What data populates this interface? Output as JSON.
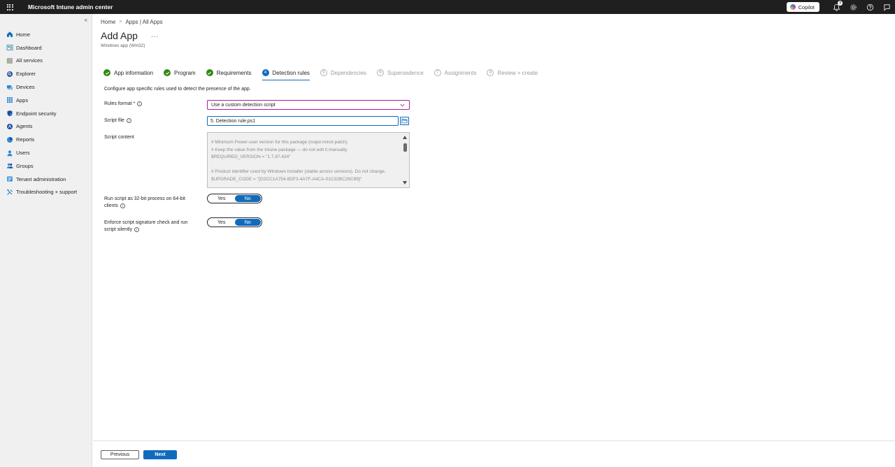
{
  "app": {
    "title": "Microsoft Intune admin center"
  },
  "topbar": {
    "copilot_label": "Copilot",
    "notification_count": "7"
  },
  "sidebar": {
    "collapse_glyph": "«",
    "items": [
      {
        "label": "Home",
        "icon": "home-icon"
      },
      {
        "label": "Dashboard",
        "icon": "dashboard-icon"
      },
      {
        "label": "All services",
        "icon": "all-services-icon"
      },
      {
        "label": "Explorer",
        "icon": "explorer-icon"
      },
      {
        "label": "Devices",
        "icon": "devices-icon"
      },
      {
        "label": "Apps",
        "icon": "apps-icon"
      },
      {
        "label": "Endpoint security",
        "icon": "endpoint-security-icon"
      },
      {
        "label": "Agents",
        "icon": "agents-icon"
      },
      {
        "label": "Reports",
        "icon": "reports-icon"
      },
      {
        "label": "Users",
        "icon": "users-icon"
      },
      {
        "label": "Groups",
        "icon": "groups-icon"
      },
      {
        "label": "Tenant administration",
        "icon": "tenant-admin-icon"
      },
      {
        "label": "Troubleshooting + support",
        "icon": "troubleshooting-icon"
      }
    ]
  },
  "breadcrumb": {
    "items": [
      "Home",
      "Apps | All Apps"
    ],
    "separator": ">"
  },
  "page": {
    "title": "Add App",
    "ellipsis": "...",
    "subtitle": "Windows app (Win32)"
  },
  "steps": [
    {
      "label": "App information",
      "status": "done",
      "number": "1"
    },
    {
      "label": "Program",
      "status": "done",
      "number": "2"
    },
    {
      "label": "Requirements",
      "status": "done",
      "number": "3"
    },
    {
      "label": "Detection rules",
      "status": "active",
      "number": "4"
    },
    {
      "label": "Dependencies",
      "status": "todo",
      "number": "5"
    },
    {
      "label": "Supersedence",
      "status": "todo",
      "number": "6"
    },
    {
      "label": "Assignments",
      "status": "todo",
      "number": "7"
    },
    {
      "label": "Review + create",
      "status": "todo",
      "number": "8"
    }
  ],
  "form": {
    "description": "Configure app specific rules used to detect the presence of the app.",
    "rules_format_label": "Rules format *",
    "rules_format_value": "Use a custom detection script",
    "script_file_label": "Script file",
    "script_file_value": "5. Detection rule.ps1",
    "script_content_label": "Script content",
    "script_content": "# Minimum Power-user version for this package (major.minor.patch).\n# Keep the value from the Intune package — do not edit it manually.\n$REQUIRED_VERSION = \"1.7.87.424\"\n\n# Product identifier used by Windows Installer (stable across versions). Do not change.\n$UPGRADE_CODE = \"{D2CC1A754-8DF3-4A7F-A4CA-01C32BC26C89}\"",
    "run32_label_line1": "Run script as 32-bit process on 64-bit",
    "run32_label_line2": "clients",
    "run32_yes": "Yes",
    "run32_no": "No",
    "run32_selected": "No",
    "sig_label_line1": "Enforce script signature check and run",
    "sig_label_line2": "script silently",
    "sig_yes": "Yes",
    "sig_no": "No",
    "sig_selected": "No"
  },
  "footer": {
    "previous_label": "Previous",
    "next_label": "Next"
  },
  "colors": {
    "accent": "#0f6cbd",
    "success": "#2f8a12",
    "topbar": "#1f1f1f",
    "focus_border": "#a4209c"
  }
}
